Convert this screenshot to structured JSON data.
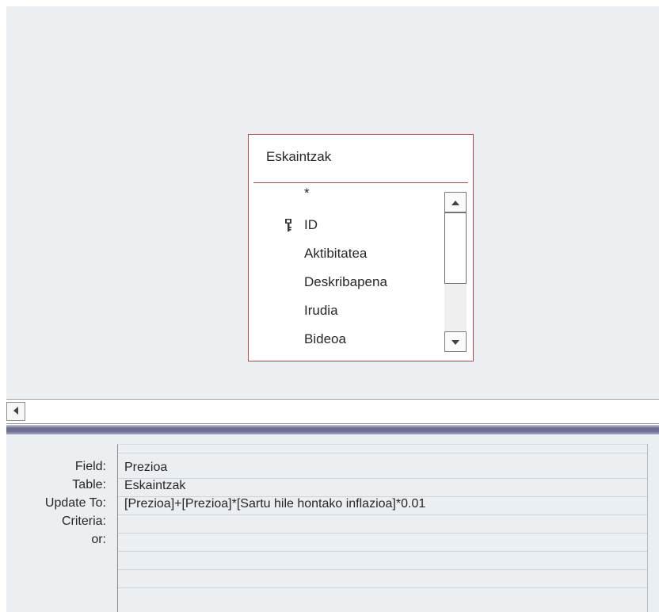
{
  "field_list": {
    "title": "Eskaintzak",
    "fields": [
      "*",
      "ID",
      "Aktibitatea",
      "Deskribapena",
      "Irudia",
      "Bideoa"
    ],
    "key_field": "ID"
  },
  "grid": {
    "labels": {
      "field": "Field:",
      "table": "Table:",
      "update_to": "Update To:",
      "criteria": "Criteria:",
      "or": "or:"
    },
    "column1": {
      "field": "Prezioa",
      "table": "Eskaintzak",
      "update_to": "[Prezioa]+[Prezioa]*[Sartu hile hontako inflazioa]*0.01",
      "criteria": "",
      "or": ""
    }
  },
  "colors": {
    "field_list_border": "#b4474a",
    "design_background": "#eceff2"
  }
}
